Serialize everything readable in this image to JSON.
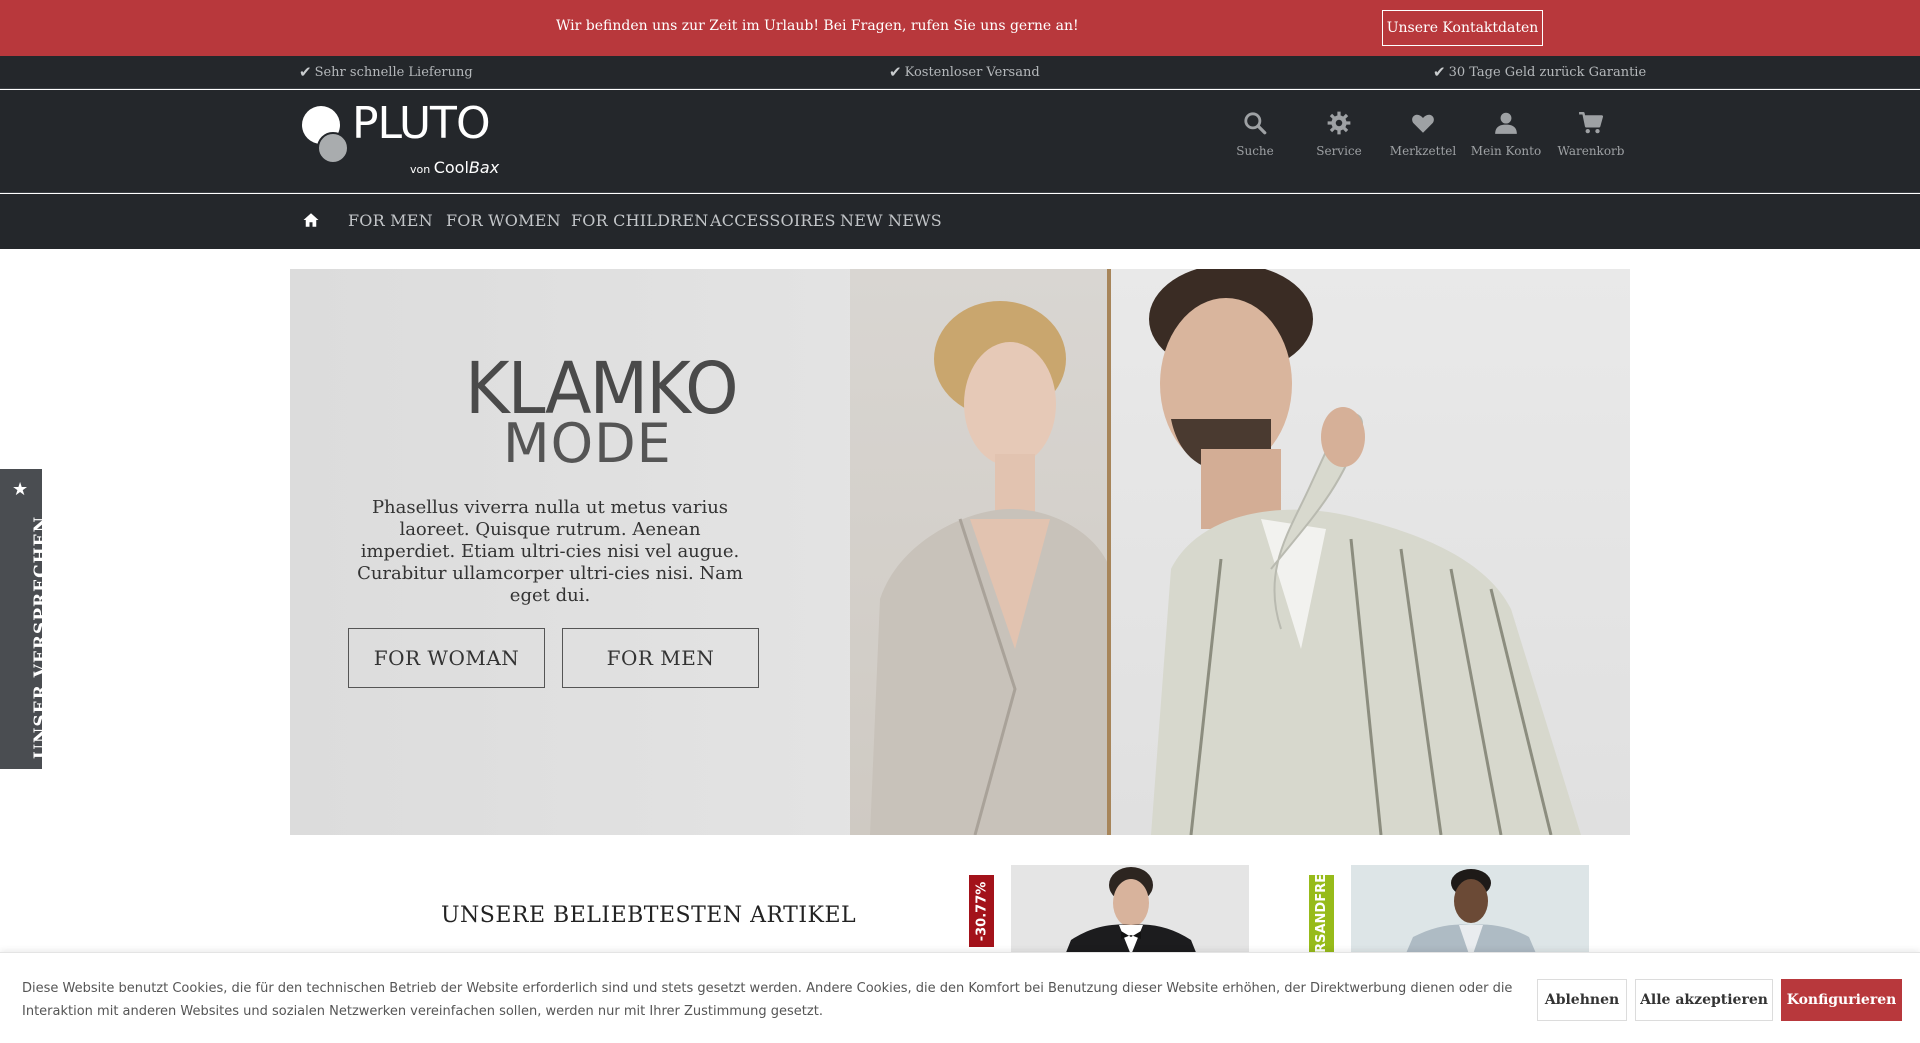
{
  "notice": {
    "text": "Wir befinden uns zur Zeit im Urlaub! Bei Fragen, rufen Sie uns gerne an!",
    "button": "Unsere Kontaktdaten"
  },
  "usp": [
    "Sehr schnelle Lieferung",
    "Kostenloser Versand",
    "30 Tage Geld zurück Garantie"
  ],
  "logo": {
    "name": "PLUTO",
    "von": "von",
    "cool": "Cool",
    "bax": "Bax"
  },
  "header_actions": [
    {
      "label": "Suche",
      "icon": "search-icon"
    },
    {
      "label": "Service",
      "icon": "gear-icon"
    },
    {
      "label": "Merkzettel",
      "icon": "heart-icon"
    },
    {
      "label": "Mein Konto",
      "icon": "user-icon"
    },
    {
      "label": "Warenkorb",
      "icon": "cart-icon"
    }
  ],
  "nav": [
    "FOR MEN",
    "FOR WOMEN",
    "FOR CHILDREN",
    "ACCESSOIRES",
    "NEW NEWS"
  ],
  "hero": {
    "brand_line1": "KLAMKO",
    "brand_line2": "MODE",
    "text": "Phasellus viverra nulla ut metus varius laoreet. Quisque rutrum. Aenean imperdiet. Etiam ultri-cies nisi vel augue. Curabitur ullamcorper ultri-cies nisi. Nam eget dui.",
    "btn_woman": "FOR WOMAN",
    "btn_men": "FOR MEN"
  },
  "side_tab": {
    "label": "UNSER VERSPRECHEN"
  },
  "bestsellers": {
    "title": "UNSERE BELIEBTESTEN ARTIKEL",
    "badges": [
      "-30.77%",
      "VERSANDFREI"
    ]
  },
  "cookie": {
    "text": "Diese Website benutzt Cookies, die für den technischen Betrieb der Website erforderlich sind und stets gesetzt werden. Andere Cookies, die den Komfort bei Benutzung dieser Website erhöhen, der Direktwerbung dienen oder die Interaktion mit anderen Websites und sozialen Netzwerken vereinfachen sollen, werden nur mit Ihrer Zustimmung gesetzt.",
    "decline": "Ablehnen",
    "accept_all": "Alle akzeptieren",
    "configure": "Konfigurieren"
  },
  "colors": {
    "accent_red": "#b8383c",
    "header_dark": "#24272b",
    "badge_sale": "#a3121a",
    "badge_free": "#97bb1a"
  }
}
